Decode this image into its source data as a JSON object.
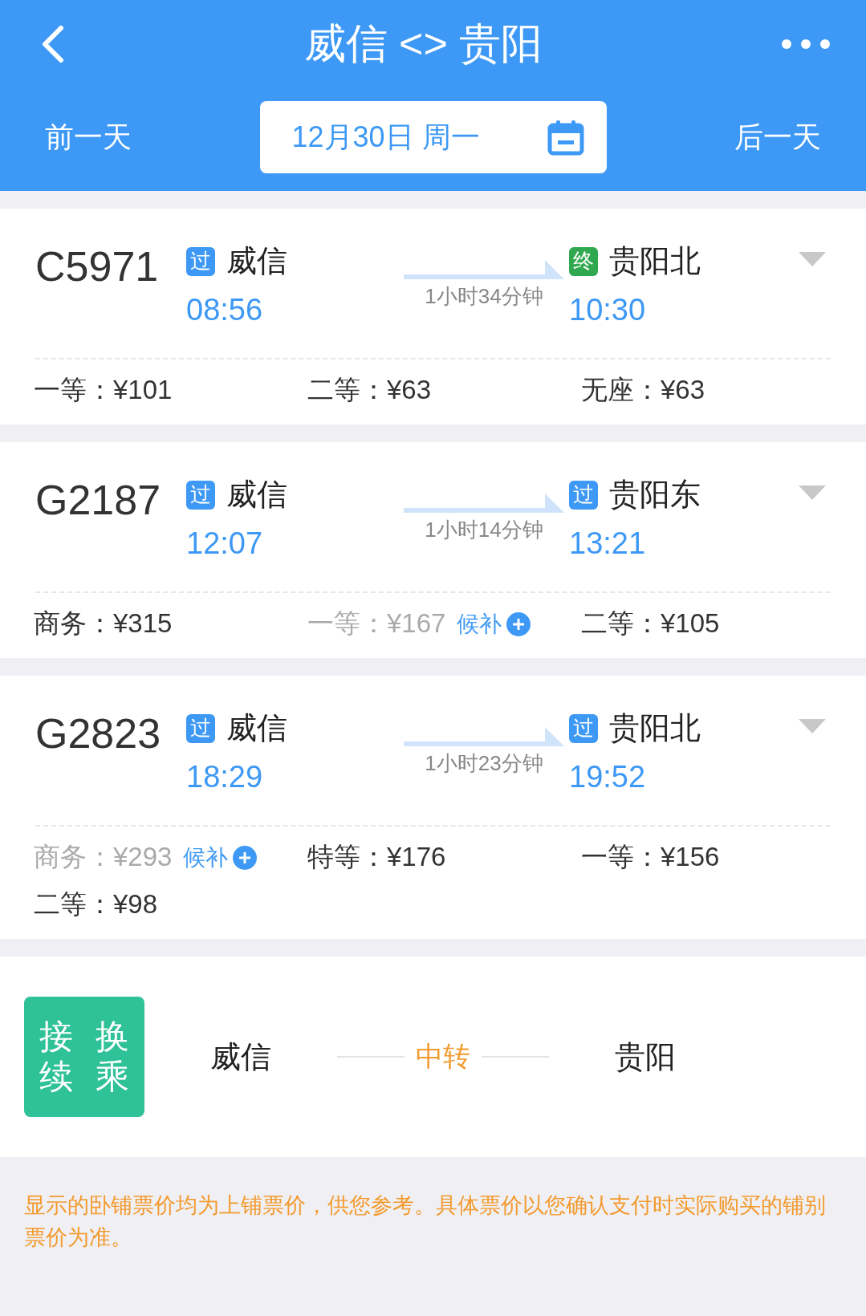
{
  "header": {
    "title": "威信 <> 贵阳",
    "prev_day": "前一天",
    "date": "12月30日 周一",
    "next_day": "后一天"
  },
  "trains": [
    {
      "number": "C5971",
      "from": {
        "badge": "过",
        "kind": "pass",
        "station": "威信",
        "time": "08:56"
      },
      "duration": "1小时34分钟",
      "to": {
        "badge": "终",
        "kind": "end",
        "station": "贵阳北",
        "time": "10:30"
      },
      "seats": [
        {
          "text": "一等：¥101",
          "available": true
        },
        {
          "text": "二等：¥63",
          "available": true
        },
        {
          "text": "无座：¥63",
          "available": true
        }
      ]
    },
    {
      "number": "G2187",
      "from": {
        "badge": "过",
        "kind": "pass",
        "station": "威信",
        "time": "12:07"
      },
      "duration": "1小时14分钟",
      "to": {
        "badge": "过",
        "kind": "pass",
        "station": "贵阳东",
        "time": "13:21"
      },
      "seats": [
        {
          "text": "商务：¥315",
          "available": true
        },
        {
          "text": "一等：¥167",
          "available": false,
          "waitlist": "候补"
        },
        {
          "text": "二等：¥105",
          "available": true
        }
      ]
    },
    {
      "number": "G2823",
      "from": {
        "badge": "过",
        "kind": "pass",
        "station": "威信",
        "time": "18:29"
      },
      "duration": "1小时23分钟",
      "to": {
        "badge": "过",
        "kind": "pass",
        "station": "贵阳北",
        "time": "19:52"
      },
      "seats": [
        {
          "text": "商务：¥293",
          "available": false,
          "waitlist": "候补"
        },
        {
          "text": "特等：¥176",
          "available": true
        },
        {
          "text": "一等：¥156",
          "available": true
        },
        {
          "text": "二等：¥98",
          "available": true
        }
      ]
    }
  ],
  "transfer": {
    "badge_columns": [
      "接续",
      "换乘"
    ],
    "from": "威信",
    "via": "中转",
    "to": "贵阳"
  },
  "note": "显示的卧铺票价均为上铺票价，供您参考。具体票价以您确认支付时实际购买的铺别票价为准。"
}
